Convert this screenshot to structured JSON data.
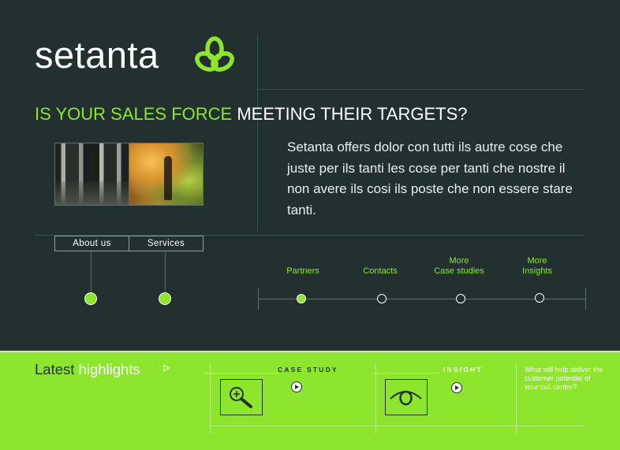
{
  "brand": {
    "name": "setanta",
    "accent_color": "#8ee52e",
    "background_color": "#223130",
    "logo_icon": "trinity-knot-icon"
  },
  "headline": {
    "highlight": "IS YOUR SALES FORCE",
    "rest": "MEETING THEIR TARGETS?"
  },
  "intro": {
    "text": "Setanta offers dolor con tutti ils autre cose che juste per ils tanti les cose per tanti che nostre il non avere ils cosi ils poste che non essere stare tanti."
  },
  "tabs": [
    {
      "label": "About us"
    },
    {
      "label": "Services"
    }
  ],
  "nav": {
    "items": [
      {
        "line1": "",
        "line2": "Partners",
        "active": true
      },
      {
        "line1": "",
        "line2": "Contacts",
        "active": false
      },
      {
        "line1": "More",
        "line2": "Case studies",
        "active": false
      },
      {
        "line1": "More",
        "line2": "Insights",
        "active": false
      }
    ]
  },
  "highlights": {
    "title_dark": "Latest",
    "title_white": "highlights",
    "case_study": {
      "label": "CASE STUDY",
      "icon": "magnifier-plus-icon"
    },
    "insight": {
      "label": "INSIGHT",
      "icon": "eye-icon"
    },
    "question": "What will help deliver the customer potential of your call centre?"
  }
}
